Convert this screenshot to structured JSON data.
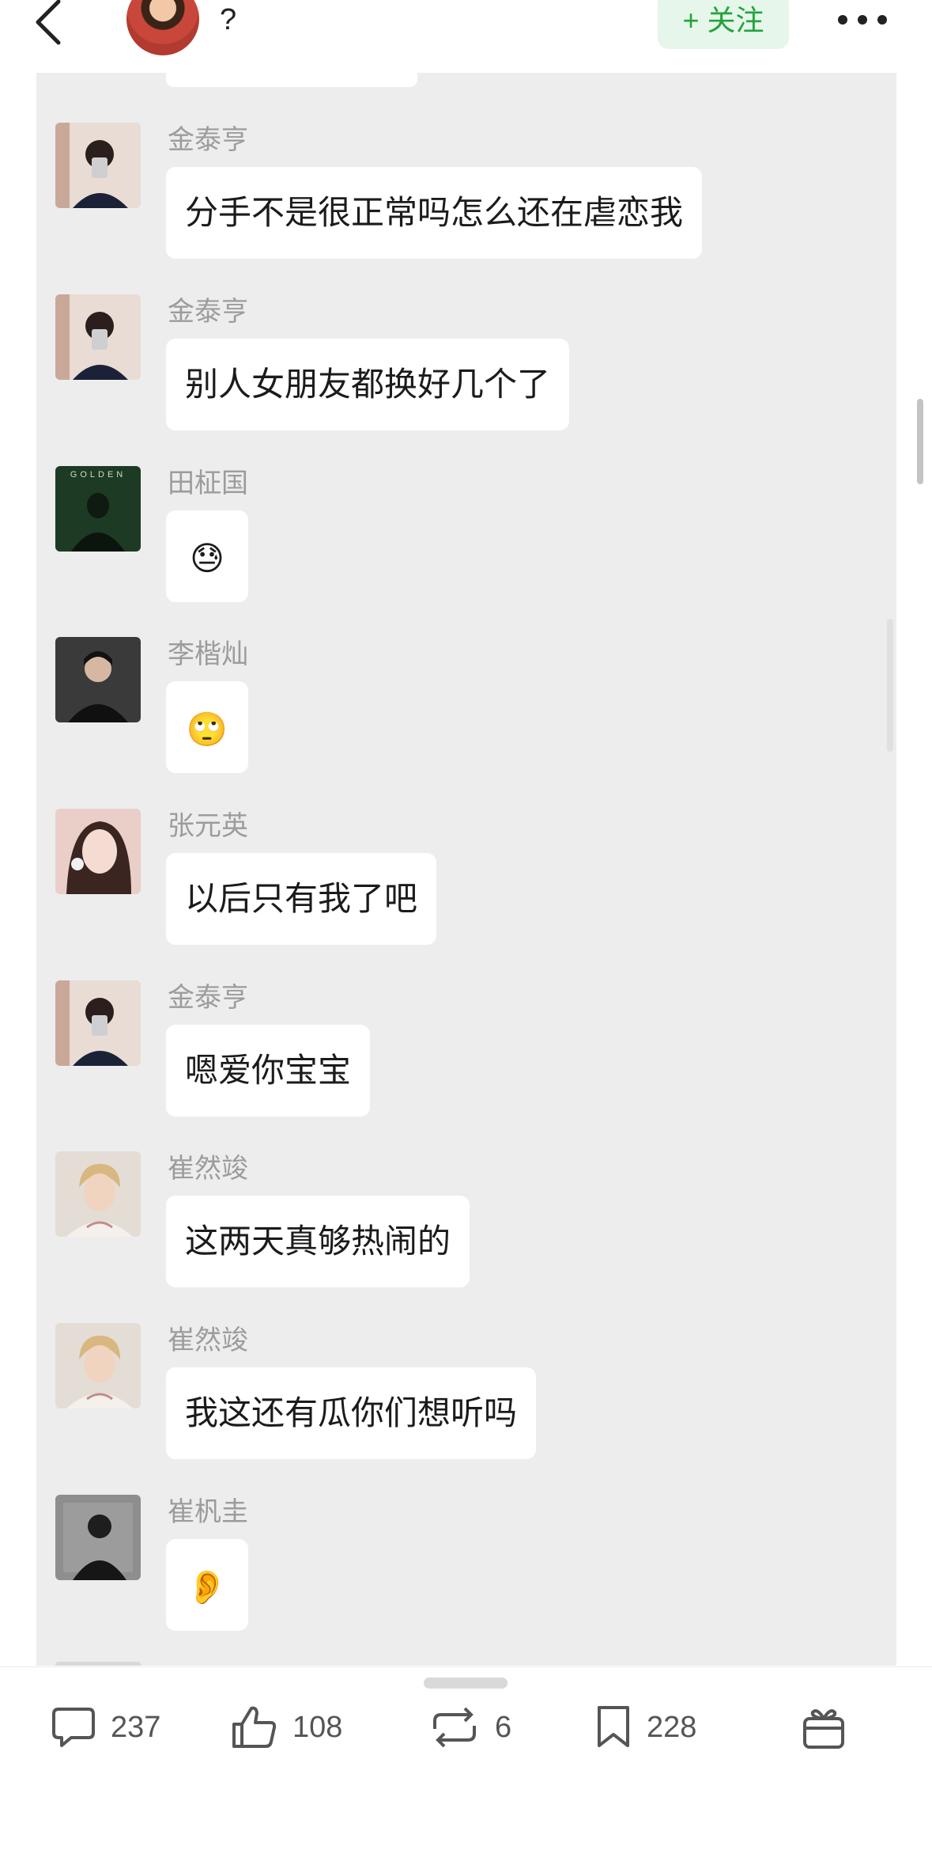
{
  "header": {
    "title": "?",
    "follow_label": "+ 关注"
  },
  "messages": [
    {
      "sender": "金泰亨",
      "text": "分手不是很正常吗怎么还在虐恋我",
      "avatar": "guy-mirror-selfie"
    },
    {
      "sender": "金泰亨",
      "text": "别人女朋友都换好几个了",
      "avatar": "guy-mirror-selfie"
    },
    {
      "sender": "田柾国",
      "text": "😓",
      "avatar": "golden-album",
      "emoji": true,
      "avatar_text": "GOLDEN"
    },
    {
      "sender": "李楷灿",
      "text": "🙄",
      "avatar": "guy-dark",
      "emoji": true
    },
    {
      "sender": "张元英",
      "text": "以后只有我了吧",
      "avatar": "girl-portrait"
    },
    {
      "sender": "金泰亨",
      "text": "嗯爱你宝宝",
      "avatar": "guy-mirror-selfie"
    },
    {
      "sender": "崔然竣",
      "text": "这两天真够热闹的",
      "avatar": "blond-guy"
    },
    {
      "sender": "崔然竣",
      "text": "我这还有瓜你们想听吗",
      "avatar": "blond-guy"
    },
    {
      "sender": "崔杋圭",
      "text": "👂",
      "avatar": "guy-gray",
      "emoji": true
    }
  ],
  "actions": {
    "comments": "237",
    "likes": "108",
    "reposts": "6",
    "favorites": "228"
  },
  "colors": {
    "follow_green": "#23a33c",
    "panel_bg": "#ededed",
    "sender_gray": "#9c9c9c"
  },
  "icons": [
    "back-icon",
    "more-icon",
    "comment-icon",
    "like-icon",
    "repost-icon",
    "favorite-icon",
    "gift-icon"
  ]
}
